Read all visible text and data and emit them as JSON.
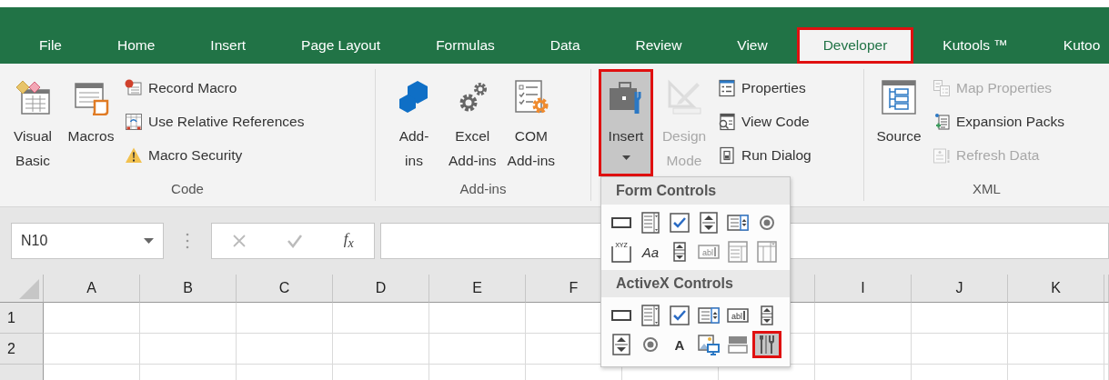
{
  "tabs": [
    {
      "label": "File",
      "selected": false,
      "highlighted": false
    },
    {
      "label": "Home",
      "selected": false,
      "highlighted": false
    },
    {
      "label": "Insert",
      "selected": false,
      "highlighted": false
    },
    {
      "label": "Page Layout",
      "selected": false,
      "highlighted": false
    },
    {
      "label": "Formulas",
      "selected": false,
      "highlighted": false
    },
    {
      "label": "Data",
      "selected": false,
      "highlighted": false
    },
    {
      "label": "Review",
      "selected": false,
      "highlighted": false
    },
    {
      "label": "View",
      "selected": false,
      "highlighted": false
    },
    {
      "label": "Developer",
      "selected": true,
      "highlighted": true
    },
    {
      "label": "Kutools ™",
      "selected": false,
      "highlighted": false
    },
    {
      "label": "Kutoo",
      "selected": false,
      "highlighted": false
    }
  ],
  "ribbon": {
    "groups": [
      {
        "label": "Code",
        "large": [
          {
            "kind": "visual-basic",
            "lines": [
              "Visual",
              "Basic"
            ],
            "disabled": false,
            "pressed": false,
            "highlighted": false,
            "dropdown": false
          },
          {
            "kind": "macros",
            "lines": [
              "Macros"
            ],
            "disabled": false,
            "pressed": false,
            "highlighted": false,
            "dropdown": false
          }
        ],
        "small": [
          {
            "kind": "record-macro",
            "label": "Record Macro",
            "disabled": false
          },
          {
            "kind": "relative-references",
            "label": "Use Relative References",
            "disabled": false
          },
          {
            "kind": "warning",
            "label": "Macro Security",
            "disabled": false
          }
        ]
      },
      {
        "label": "Add-ins",
        "large": [
          {
            "kind": "add-ins",
            "lines": [
              "Add-",
              "ins"
            ],
            "disabled": false,
            "pressed": false,
            "highlighted": false,
            "dropdown": false
          },
          {
            "kind": "excel-add-ins",
            "lines": [
              "Excel",
              "Add-ins"
            ],
            "disabled": false,
            "pressed": false,
            "highlighted": false,
            "dropdown": false
          },
          {
            "kind": "com-add-ins",
            "lines": [
              "COM",
              "Add-ins"
            ],
            "disabled": false,
            "pressed": false,
            "highlighted": false,
            "dropdown": false
          }
        ]
      },
      {
        "large": [
          {
            "kind": "insert-controls",
            "lines": [
              "Insert"
            ],
            "disabled": false,
            "pressed": true,
            "highlighted": true,
            "dropdown": true
          },
          {
            "kind": "design-mode",
            "lines": [
              "Design",
              "Mode"
            ],
            "disabled": true,
            "pressed": false,
            "highlighted": false,
            "dropdown": false
          }
        ],
        "small": [
          {
            "kind": "properties",
            "label": "Properties",
            "disabled": false
          },
          {
            "kind": "view-code",
            "label": "View Code",
            "disabled": false
          },
          {
            "kind": "run-dialog",
            "label": "Run Dialog",
            "disabled": false
          }
        ]
      },
      {
        "label": "XML",
        "large": [
          {
            "kind": "source",
            "lines": [
              "Source"
            ],
            "disabled": false,
            "pressed": false,
            "highlighted": false,
            "dropdown": false
          }
        ],
        "small": [
          {
            "kind": "map-properties",
            "label": "Map Properties",
            "disabled": true
          },
          {
            "kind": "expansion-packs",
            "label": "Expansion Packs",
            "disabled": false
          },
          {
            "kind": "refresh-data",
            "label": "Refresh Data",
            "disabled": true
          }
        ]
      }
    ]
  },
  "formula_bar": {
    "name_box": "N10",
    "insert_function": "f$_{x}$"
  },
  "sheet": {
    "columns": [
      "A",
      "B",
      "C",
      "D",
      "E",
      "F",
      null,
      null,
      "I",
      "J",
      "K"
    ],
    "rows": [
      "1",
      "2"
    ]
  },
  "insert_menu": {
    "sections": [
      {
        "title": "Form Controls",
        "items": [
          {
            "kind": "button",
            "disabled": false,
            "highlighted": false
          },
          {
            "kind": "combo-box",
            "disabled": false,
            "highlighted": false
          },
          {
            "kind": "checkbox",
            "disabled": false,
            "highlighted": false
          },
          {
            "kind": "spin-button",
            "disabled": false,
            "highlighted": false
          },
          {
            "kind": "list-box",
            "disabled": false,
            "highlighted": false
          },
          {
            "kind": "option-button",
            "disabled": false,
            "highlighted": false
          },
          {
            "kind": "group-box",
            "glyph": "XYZ",
            "disabled": false,
            "highlighted": false
          },
          {
            "kind": "label",
            "glyph": "Aa",
            "disabled": false,
            "highlighted": false
          },
          {
            "kind": "scroll-bar",
            "disabled": false,
            "highlighted": false
          },
          {
            "kind": "text-box",
            "glyph": "abl",
            "disabled": true,
            "highlighted": false
          },
          {
            "kind": "combo-list",
            "disabled": true,
            "highlighted": false
          },
          {
            "kind": "combo-drop",
            "disabled": true,
            "highlighted": false
          }
        ]
      },
      {
        "title": "ActiveX Controls",
        "items": [
          {
            "kind": "button",
            "disabled": false,
            "highlighted": false
          },
          {
            "kind": "combo-box",
            "disabled": false,
            "highlighted": false
          },
          {
            "kind": "checkbox",
            "disabled": false,
            "highlighted": false
          },
          {
            "kind": "list-box",
            "disabled": false,
            "highlighted": false
          },
          {
            "kind": "text-box",
            "glyph": "abl",
            "disabled": false,
            "highlighted": false
          },
          {
            "kind": "scroll-bar",
            "disabled": false,
            "highlighted": false
          },
          {
            "kind": "spin-button",
            "disabled": false,
            "highlighted": false
          },
          {
            "kind": "option-button",
            "disabled": false,
            "highlighted": false
          },
          {
            "kind": "label",
            "glyph": "A",
            "disabled": false,
            "highlighted": false
          },
          {
            "kind": "image",
            "disabled": false,
            "highlighted": false
          },
          {
            "kind": "toggle-button",
            "disabled": false,
            "highlighted": false
          },
          {
            "kind": "more-controls",
            "disabled": false,
            "highlighted": true
          }
        ]
      }
    ]
  }
}
